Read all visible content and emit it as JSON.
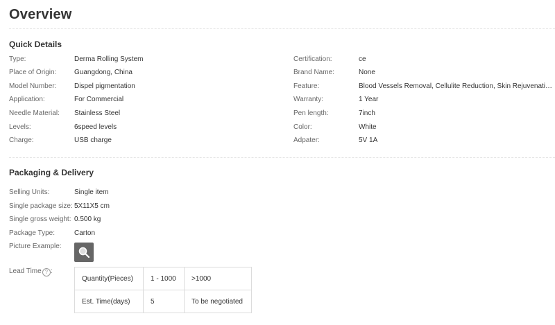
{
  "page_title": "Overview",
  "quick_details": {
    "title": "Quick Details",
    "left": [
      {
        "label": "Type:",
        "value": "Derma Rolling System"
      },
      {
        "label": "Place of Origin:",
        "value": "Guangdong, China"
      },
      {
        "label": "Model Number:",
        "value": "Dispel pigmentation"
      },
      {
        "label": "Application:",
        "value": "For Commercial"
      },
      {
        "label": "Needle Material:",
        "value": "Stainless Steel"
      },
      {
        "label": "Levels:",
        "value": "6speed levels"
      },
      {
        "label": "Charge:",
        "value": "USB charge"
      }
    ],
    "right": [
      {
        "label": "Certification:",
        "value": "ce"
      },
      {
        "label": "Brand Name:",
        "value": "None"
      },
      {
        "label": "Feature:",
        "value": "Blood Vessels Removal, Cellulite Reduction, Skin Rejuvenatio..."
      },
      {
        "label": "Warranty:",
        "value": "1 Year"
      },
      {
        "label": "Pen length:",
        "value": "7inch"
      },
      {
        "label": "Color:",
        "value": "White"
      },
      {
        "label": "Adpater:",
        "value": "5V 1A"
      }
    ]
  },
  "packaging": {
    "title": "Packaging & Delivery",
    "items": [
      {
        "label": "Selling Units:",
        "value": "Single item"
      },
      {
        "label": "Single package size:",
        "value": "5X11X5 cm"
      },
      {
        "label": "Single gross weight:",
        "value": "0.500 kg"
      },
      {
        "label": "Package Type:",
        "value": "Carton"
      }
    ],
    "picture_label": "Picture Example:",
    "picture_icon": "zoom-icon",
    "lead_time_label": "Lead Time",
    "help_icon": "?",
    "lead_table": [
      [
        "Quantity(Pieces)",
        "1 - 1000",
        ">1000"
      ],
      [
        "Est. Time(days)",
        "5",
        "To be negotiated"
      ]
    ]
  }
}
